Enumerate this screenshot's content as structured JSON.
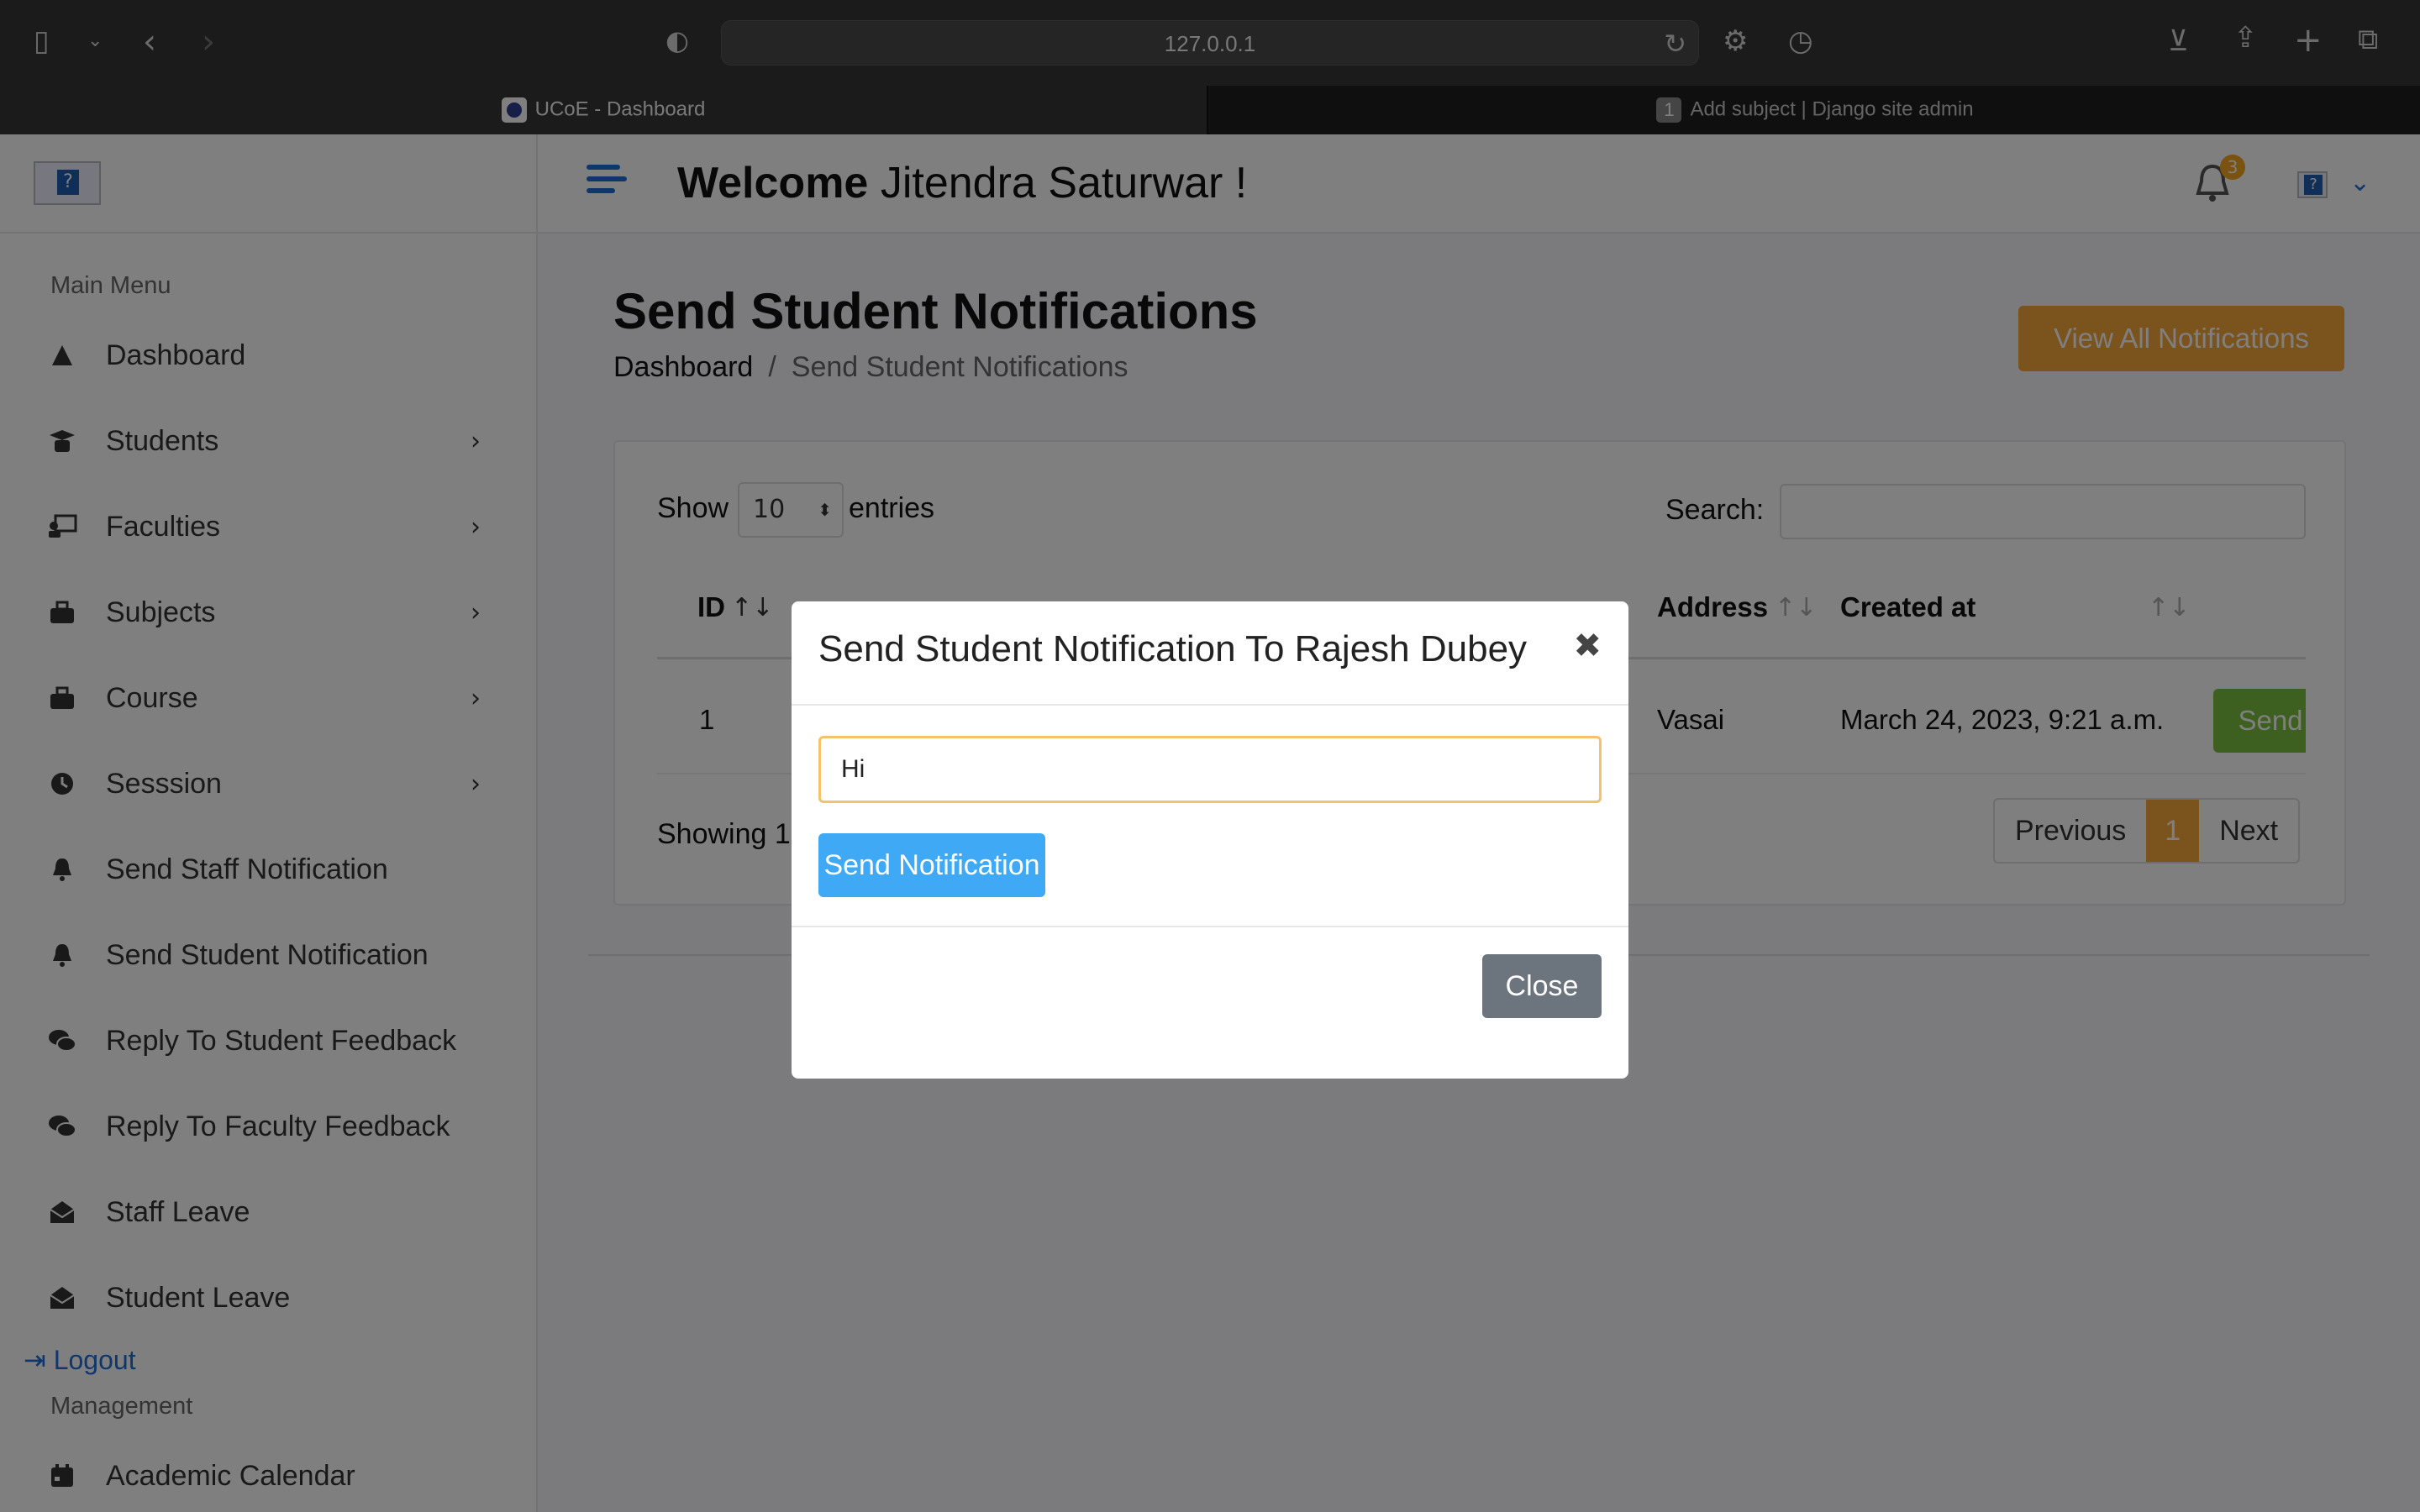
{
  "browser": {
    "url": "127.0.0.1",
    "tabs": [
      {
        "label": "UCoE - Dashboard",
        "active": true
      },
      {
        "badge": "1",
        "label": "Add subject | Django site admin",
        "active": false
      }
    ]
  },
  "header": {
    "welcome_bold": "Welcome",
    "welcome_name": "Jitendra Saturwar  !",
    "notification_count": "3"
  },
  "sidebar": {
    "main_menu_title": "Main Menu",
    "items": [
      {
        "label": "Dashboard",
        "icon": "dashboard-icon",
        "has_submenu": false
      },
      {
        "label": "Students",
        "icon": "student-icon",
        "has_submenu": true
      },
      {
        "label": "Faculties",
        "icon": "faculty-icon",
        "has_submenu": true
      },
      {
        "label": "Subjects",
        "icon": "subject-icon",
        "has_submenu": true
      },
      {
        "label": "Course",
        "icon": "course-icon",
        "has_submenu": true
      },
      {
        "label": "Sesssion",
        "icon": "clock-icon",
        "has_submenu": true
      },
      {
        "label": "Send Staff Notification",
        "icon": "bell-icon",
        "has_submenu": false
      },
      {
        "label": "Send Student Notification",
        "icon": "bell-icon",
        "has_submenu": false
      },
      {
        "label": "Reply To Student Feedback",
        "icon": "comments-icon",
        "has_submenu": false
      },
      {
        "label": "Reply To Faculty Feedback",
        "icon": "comments-icon",
        "has_submenu": false
      },
      {
        "label": "Staff Leave",
        "icon": "envelope-open-icon",
        "has_submenu": false
      },
      {
        "label": "Student Leave",
        "icon": "envelope-open-icon",
        "has_submenu": false
      }
    ],
    "logout_label": "Logout",
    "management_title": "Management",
    "management_items": [
      {
        "label": "Academic Calendar",
        "icon": "calendar-icon"
      }
    ]
  },
  "page": {
    "title": "Send Student Notifications",
    "breadcrumb_home": "Dashboard",
    "breadcrumb_sep": "/",
    "breadcrumb_current": "Send Student Notifications",
    "view_all_label": "View All Notifications"
  },
  "table": {
    "show_label": "Show",
    "entries_value": "10",
    "entries_label": "entries",
    "search_label": "Search:",
    "search_value": "",
    "columns": [
      "ID",
      "Address",
      "Created at"
    ],
    "rows": [
      {
        "id": "1",
        "address": "Vasai",
        "created_at": "March 24, 2023, 9:21 a.m.",
        "action": "Send"
      }
    ],
    "showing_text": "Showing 1",
    "pagination": {
      "previous": "Previous",
      "current": "1",
      "next": "Next"
    }
  },
  "modal": {
    "title": "Send Student Notification To Rajesh Dubey",
    "close_x": "✖",
    "message_value": "Hi",
    "send_label": "Send Notification",
    "close_label": "Close"
  },
  "colors": {
    "accent_blue": "#1e6fd9",
    "orange": "#f4a73b",
    "green": "#7ac142",
    "modal_send": "#3fa9f5",
    "close_gray": "#6c757d"
  }
}
